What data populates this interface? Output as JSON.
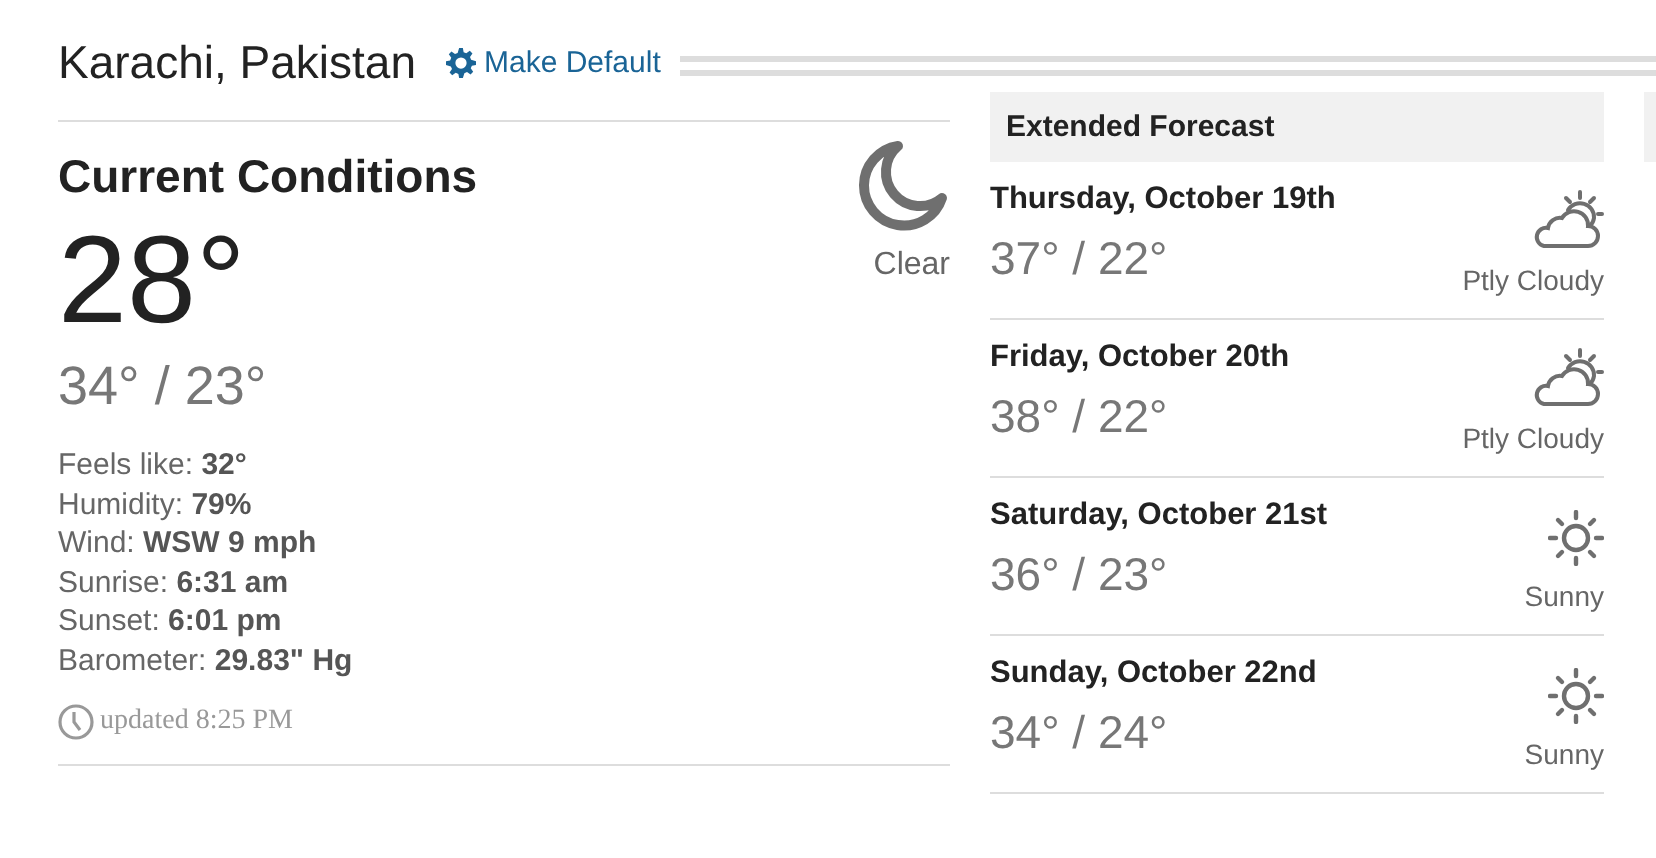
{
  "location": {
    "title": "Karachi, Pakistan",
    "action": "Make Default"
  },
  "current": {
    "heading": "Current Conditions",
    "temperature": "28°",
    "high_low": "34° / 23°",
    "condition": {
      "kind": "moon",
      "label": "Clear"
    },
    "details": [
      "Feels like: **32°**",
      "Humidity: **79%**",
      "Wind: **WSW 9 mph**",
      "Sunrise: **6:31 am**",
      "Sunset: **6:01 pm**",
      "Barometer: **29.83\" Hg**"
    ],
    "updated": "updated 8:25 PM"
  },
  "forecast": {
    "heading": "Extended Forecast",
    "days": [
      {
        "date": "Thursday, October 19th",
        "high_low": "37° / 22°",
        "kind": "partly-cloudy",
        "condition": "Ptly Cloudy"
      },
      {
        "date": "Friday, October 20th",
        "high_low": "38° / 22°",
        "kind": "partly-cloudy",
        "condition": "Ptly Cloudy"
      },
      {
        "date": "Saturday, October 21st",
        "high_low": "36° / 23°",
        "kind": "sunny",
        "condition": "Sunny"
      },
      {
        "date": "Sunday, October 22nd",
        "high_low": "34° / 24°",
        "kind": "sunny",
        "condition": "Sunny"
      }
    ]
  }
}
